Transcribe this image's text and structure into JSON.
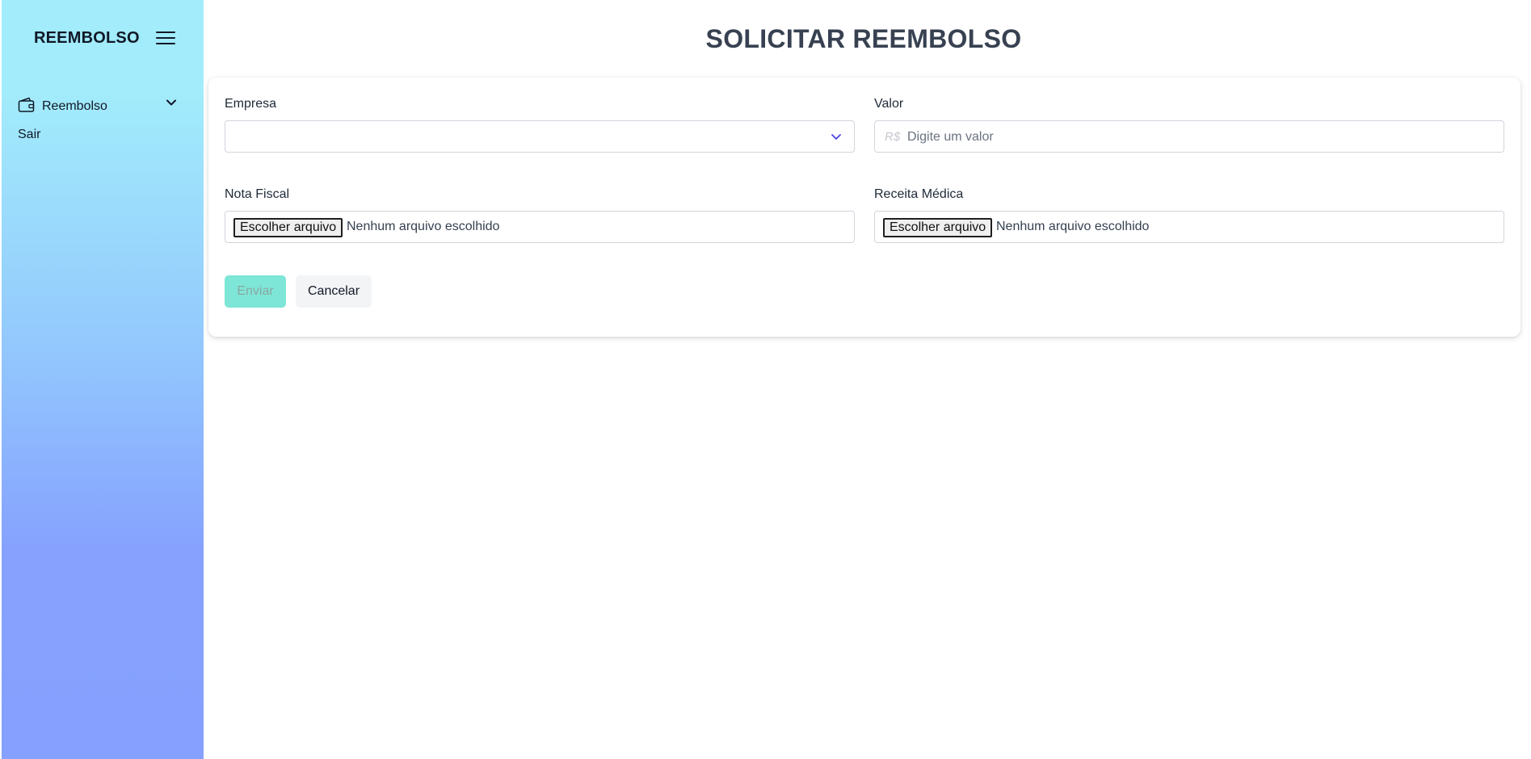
{
  "sidebar": {
    "brand": "REEMBOLSO",
    "menu_icon": "hamburger-icon",
    "items": [
      {
        "label": "Reembolso",
        "icon": "wallet-icon",
        "expand_icon": "chevron-down-icon"
      },
      {
        "label": "Sair"
      }
    ]
  },
  "main": {
    "title": "SOLICITAR REEMBOLSO",
    "form": {
      "empresa": {
        "label": "Empresa",
        "value": "",
        "caret_icon": "chevron-down-icon"
      },
      "valor": {
        "label": "Valor",
        "prefix": "R$",
        "placeholder": "Digite um valor",
        "value": ""
      },
      "nota_fiscal": {
        "label": "Nota Fiscal",
        "button_label": "Escolher arquivo",
        "status": "Nenhum arquivo escolhido"
      },
      "receita_medica": {
        "label": "Receita Médica",
        "button_label": "Escolher arquivo",
        "status": "Nenhum arquivo escolhido"
      },
      "submit_label": "Enviar",
      "cancel_label": "Cancelar"
    }
  },
  "colors": {
    "sidebar_top": "#a2ecfb",
    "sidebar_bottom": "#85a0fe",
    "submit_bg": "#7ee6d6",
    "caret": "#4f46e5",
    "title": "#374151"
  }
}
